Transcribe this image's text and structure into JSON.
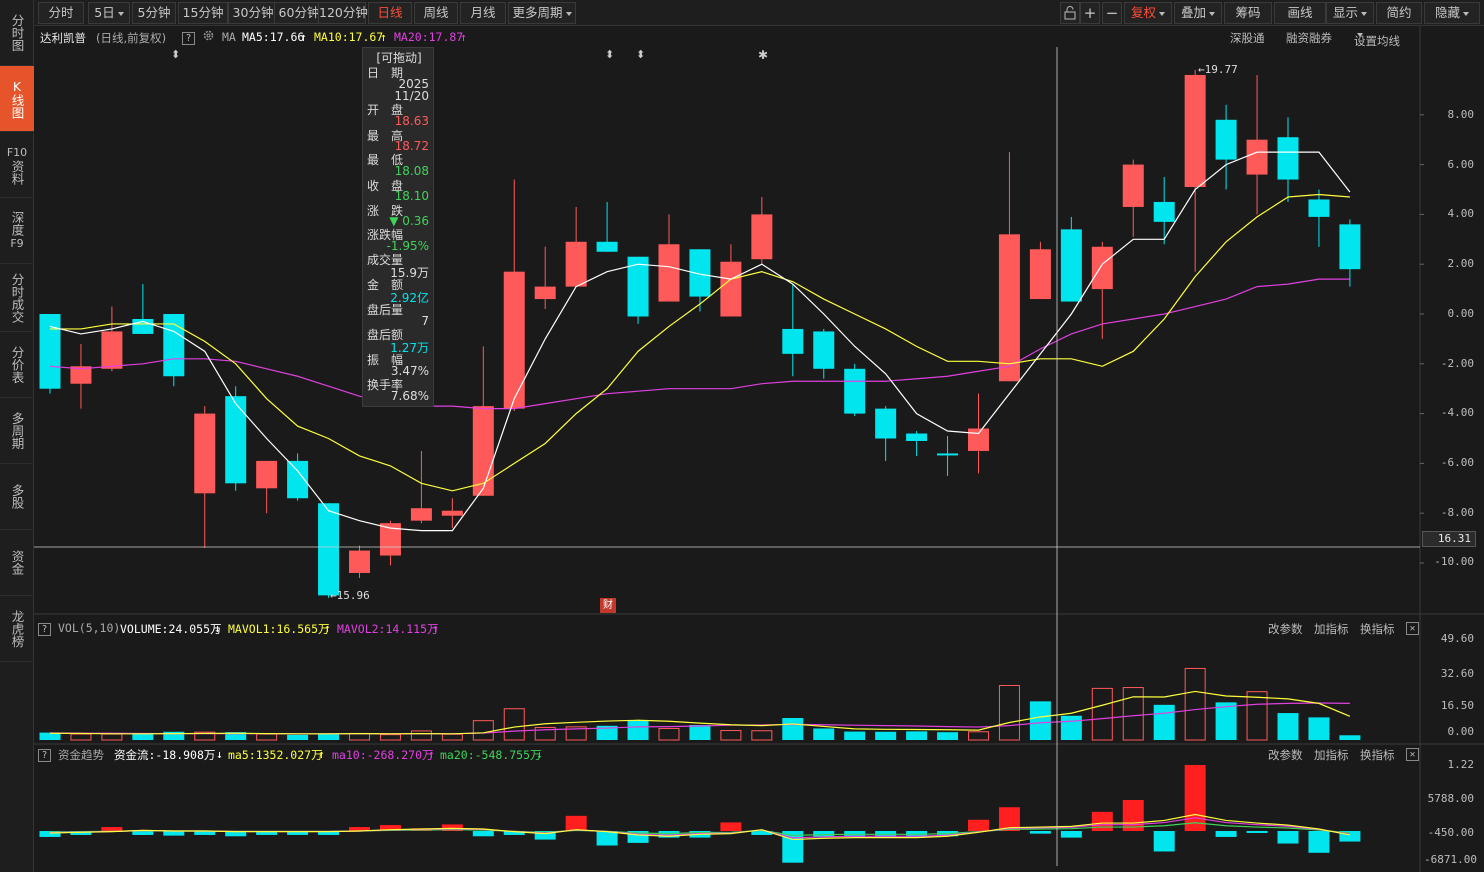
{
  "sidebar": {
    "items": [
      {
        "label": "分时图"
      },
      {
        "label": "K线图"
      },
      {
        "label_top": "F10",
        "label": "资料"
      },
      {
        "label": "深度",
        "label_bottom": "F9"
      },
      {
        "label": "分时成交"
      },
      {
        "label": "分价表"
      },
      {
        "label": "多周期"
      },
      {
        "label": "多股"
      },
      {
        "label": "资金"
      },
      {
        "label": "龙虎榜"
      }
    ]
  },
  "toolbar": {
    "periods": [
      "分时",
      "5日",
      "5分钟",
      "15分钟",
      "30分钟",
      "60分钟",
      "120分钟",
      "日线",
      "周线",
      "月线",
      "更多周期"
    ],
    "active_period": "日线",
    "right_buttons": [
      "复权",
      "叠加",
      "筹码",
      "画线",
      "显示",
      "简约",
      "隐藏"
    ]
  },
  "info": {
    "stock_name": "达利凯普",
    "mode": "(日线,前复权)",
    "ma_label": "MA",
    "ma5": "MA5:17.66",
    "ma10": "MA10:17.67",
    "ma20": "MA20:17.87",
    "links": [
      "深股通",
      "融资融券",
      "设置均线"
    ]
  },
  "tooltip": {
    "title": "[可拖动]",
    "date_label": "日　期",
    "date_year": "2025",
    "date_md": "11/20",
    "open_label": "开　盘",
    "open": "18.63",
    "high_label": "最　高",
    "high": "18.72",
    "low_label": "最　低",
    "low": "18.08",
    "close_label": "收　盘",
    "close": "18.10",
    "change_label": "涨　跌",
    "change": "▼ 0.36",
    "pct_label": "涨跌幅",
    "pct": "-1.95%",
    "vol_label": "成交量",
    "vol": "15.9万",
    "amt_label": "金　额",
    "amt": "2.92亿",
    "ah_vol_label": "盘后量",
    "ah_vol": "7",
    "ah_amt_label": "盘后额",
    "ah_amt": "1.27万",
    "amp_label": "振　幅",
    "amp": "3.47%",
    "turn_label": "换手率",
    "turn": "7.68%"
  },
  "price_axis": [
    "8.00",
    "6.00",
    "4.00",
    "2.00",
    "0.00",
    "-2.00",
    "-4.00",
    "-6.00",
    "-8.00",
    "-10.00"
  ],
  "crosshair_value": "16.31",
  "high_marker": "19.77",
  "low_marker": "15.96",
  "cai_badge": "财",
  "vol_panel": {
    "name": "VOL(5,10)",
    "volume": "VOLUME:24.055万",
    "mavol1": "MAVOL1:16.565万",
    "mavol2": "MAVOL2:14.115万",
    "axis": [
      "49.60",
      "32.60",
      "16.50",
      "0.00"
    ]
  },
  "fund_panel": {
    "name": "资金趋势",
    "flow": "资金流:-18.908万",
    "ma5": "ma5:1352.027万",
    "ma10": "ma10:-268.270万",
    "ma20": "ma20:-548.755万",
    "axis": [
      "1.22",
      "5788.00",
      "-450.00",
      "-6871.00"
    ]
  },
  "panel_links": [
    "改参数",
    "加指标",
    "换指标"
  ],
  "colors": {
    "up": "#ff5a5a",
    "down": "#00e5ee",
    "ma5": "#ffffff",
    "ma10": "#ffff3c",
    "ma20": "#e040e0",
    "accent": "#e5542a"
  },
  "chart_data": {
    "type": "candlestick",
    "price_axis_range": [
      -10.0,
      8.0
    ],
    "candles": [
      {
        "o": 0.0,
        "c": -3.0,
        "h": 0.0,
        "l": -3.2,
        "up": false
      },
      {
        "o": -2.8,
        "c": -2.1,
        "h": -1.2,
        "l": -3.8,
        "up": true
      },
      {
        "o": -2.2,
        "c": -0.7,
        "h": 0.3,
        "l": -2.3,
        "up": true
      },
      {
        "o": -0.2,
        "c": -0.8,
        "h": 1.2,
        "l": -0.8,
        "up": false
      },
      {
        "o": 0.0,
        "c": -2.5,
        "h": 0.0,
        "l": -2.9,
        "up": false
      },
      {
        "o": -7.2,
        "c": -4.0,
        "h": -3.7,
        "l": -9.4,
        "up": true
      },
      {
        "o": -3.3,
        "c": -6.8,
        "h": -2.9,
        "l": -7.1,
        "up": false
      },
      {
        "o": -7.0,
        "c": -5.9,
        "h": -5.9,
        "l": -8.0,
        "up": true
      },
      {
        "o": -5.9,
        "c": -7.4,
        "h": -5.6,
        "l": -7.5,
        "up": false
      },
      {
        "o": -7.6,
        "c": -11.3,
        "h": -7.6,
        "l": -11.4,
        "up": false
      },
      {
        "o": -10.4,
        "c": -9.5,
        "h": -9.3,
        "l": -10.6,
        "up": true
      },
      {
        "o": -9.7,
        "c": -8.4,
        "h": -8.3,
        "l": -10.1,
        "up": true
      },
      {
        "o": -8.3,
        "c": -7.8,
        "h": -5.5,
        "l": -8.4,
        "up": true
      },
      {
        "o": -8.1,
        "c": -7.9,
        "h": -7.4,
        "l": -8.6,
        "up": true
      },
      {
        "o": -7.3,
        "c": -3.7,
        "h": -1.3,
        "l": -7.3,
        "up": true
      },
      {
        "o": -3.8,
        "c": 1.7,
        "h": 5.4,
        "l": -3.9,
        "up": true
      },
      {
        "o": 0.6,
        "c": 1.1,
        "h": 2.7,
        "l": 0.2,
        "up": true
      },
      {
        "o": 1.1,
        "c": 2.9,
        "h": 4.3,
        "l": 1.1,
        "up": true
      },
      {
        "o": 2.9,
        "c": 2.5,
        "h": 4.5,
        "l": 2.5,
        "up": false
      },
      {
        "o": 2.3,
        "c": -0.1,
        "h": 2.3,
        "l": -0.4,
        "up": false
      },
      {
        "o": 0.5,
        "c": 2.8,
        "h": 4.0,
        "l": 0.5,
        "up": true
      },
      {
        "o": 2.6,
        "c": 0.7,
        "h": 2.6,
        "l": 0.1,
        "up": false
      },
      {
        "o": -0.1,
        "c": 2.1,
        "h": 2.8,
        "l": -0.1,
        "up": true
      },
      {
        "o": 2.2,
        "c": 4.0,
        "h": 4.7,
        "l": 2.0,
        "up": true
      },
      {
        "o": -0.6,
        "c": -1.6,
        "h": 1.2,
        "l": -2.5,
        "up": false
      },
      {
        "o": -0.7,
        "c": -2.2,
        "h": -0.6,
        "l": -2.6,
        "up": false
      },
      {
        "o": -2.2,
        "c": -4.0,
        "h": -2.0,
        "l": -4.1,
        "up": false
      },
      {
        "o": -3.8,
        "c": -5.0,
        "h": -3.7,
        "l": -5.9,
        "up": false
      },
      {
        "o": -4.8,
        "c": -5.1,
        "h": -4.7,
        "l": -5.7,
        "up": false
      },
      {
        "o": -5.6,
        "c": -5.6,
        "h": -4.9,
        "l": -6.5,
        "up": false
      },
      {
        "o": -5.5,
        "c": -4.6,
        "h": -3.2,
        "l": -6.4,
        "up": true
      },
      {
        "o": -2.7,
        "c": 3.2,
        "h": 6.5,
        "l": -2.7,
        "up": true
      },
      {
        "o": 0.6,
        "c": 2.6,
        "h": 2.9,
        "l": 0.6,
        "up": true
      },
      {
        "o": 3.4,
        "c": 0.5,
        "h": 3.9,
        "l": 0.5,
        "up": false
      },
      {
        "o": 1.0,
        "c": 2.7,
        "h": 2.9,
        "l": -1.0,
        "up": true
      },
      {
        "o": 4.3,
        "c": 6.0,
        "h": 6.2,
        "l": 3.1,
        "up": true
      },
      {
        "o": 4.5,
        "c": 3.7,
        "h": 5.5,
        "l": 2.8,
        "up": false
      },
      {
        "o": 5.1,
        "c": 9.6,
        "h": 9.8,
        "l": 1.7,
        "up": true
      },
      {
        "o": 7.8,
        "c": 6.2,
        "h": 8.4,
        "l": 5.0,
        "up": false
      },
      {
        "o": 5.6,
        "c": 7.0,
        "h": 9.6,
        "l": 4.0,
        "up": true
      },
      {
        "o": 7.1,
        "c": 5.4,
        "h": 7.9,
        "l": 4.5,
        "up": false
      },
      {
        "o": 4.6,
        "c": 3.9,
        "h": 5.0,
        "l": 2.7,
        "up": false
      },
      {
        "o": 3.6,
        "c": 1.8,
        "h": 3.8,
        "l": 1.1,
        "up": false
      }
    ],
    "ma5": [
      -0.5,
      -0.8,
      -0.6,
      -0.3,
      -0.7,
      -1.5,
      -3.6,
      -5.0,
      -6.3,
      -7.9,
      -8.3,
      -8.6,
      -8.7,
      -8.7,
      -7.0,
      -3.4,
      -1.0,
      1.1,
      1.7,
      2.0,
      1.9,
      1.6,
      1.4,
      2.0,
      1.2,
      0.0,
      -1.3,
      -2.4,
      -4.0,
      -4.7,
      -4.8,
      -3.2,
      -1.6,
      0.0,
      2.0,
      3.0,
      3.0,
      5.0,
      6.0,
      6.5,
      6.5,
      6.5,
      4.9
    ],
    "ma10": [
      -0.6,
      -0.6,
      -0.4,
      -0.4,
      -0.4,
      -1.1,
      -2.0,
      -3.4,
      -4.5,
      -5.0,
      -5.7,
      -6.1,
      -6.8,
      -7.1,
      -6.8,
      -6.0,
      -5.2,
      -4.0,
      -3.0,
      -1.5,
      -0.5,
      0.4,
      1.4,
      1.7,
      1.3,
      0.6,
      0.0,
      -0.6,
      -1.3,
      -1.9,
      -1.9,
      -2.0,
      -1.8,
      -1.8,
      -2.1,
      -1.5,
      -0.2,
      1.5,
      2.9,
      3.9,
      4.7,
      4.8,
      4.7
    ],
    "ma20": [
      -2.1,
      -2.2,
      -2.1,
      -2.0,
      -1.8,
      -1.8,
      -1.9,
      -2.2,
      -2.5,
      -2.9,
      -3.3,
      -3.6,
      -3.7,
      -3.7,
      -3.8,
      -3.8,
      -3.6,
      -3.4,
      -3.2,
      -3.1,
      -3.0,
      -3.0,
      -3.0,
      -2.8,
      -2.7,
      -2.7,
      -2.7,
      -2.7,
      -2.6,
      -2.5,
      -2.3,
      -2.1,
      -1.4,
      -0.8,
      -0.4,
      -0.2,
      0.0,
      0.3,
      0.6,
      1.1,
      1.2,
      1.4,
      1.4
    ],
    "volume": [
      3.6,
      2.9,
      2.9,
      3.1,
      4.0,
      3.8,
      3.8,
      2.9,
      2.5,
      3.2,
      3.2,
      2.6,
      4.4,
      2.8,
      9.4,
      15.2,
      6.1,
      6.4,
      6.9,
      9.6,
      5.6,
      7.3,
      4.6,
      4.5,
      10.7,
      5.6,
      4.1,
      4.0,
      4.2,
      3.8,
      4.0,
      26.5,
      18.8,
      11.8,
      25.1,
      25.5,
      17.1,
      34.8,
      18.3,
      23.5,
      13.1,
      11.0,
      2.3
    ],
    "vol_up": [
      false,
      true,
      true,
      false,
      false,
      true,
      false,
      true,
      false,
      false,
      true,
      true,
      true,
      true,
      true,
      true,
      true,
      true,
      false,
      false,
      true,
      false,
      true,
      true,
      false,
      false,
      false,
      false,
      false,
      false,
      true,
      true,
      false,
      false,
      true,
      true,
      false,
      true,
      false,
      true,
      false,
      false,
      false
    ],
    "mavol1": [
      3.3,
      3.2,
      3.0,
      3.0,
      3.1,
      3.2,
      3.3,
      3.1,
      3.0,
      3.0,
      3.1,
      3.0,
      3.1,
      3.0,
      3.5,
      6.3,
      7.9,
      8.6,
      9.2,
      9.6,
      9.1,
      8.2,
      7.4,
      7.0,
      7.8,
      6.6,
      5.4,
      5.2,
      5.1,
      5.0,
      4.8,
      8.5,
      11.2,
      13.0,
      16.9,
      21.0,
      20.9,
      23.6,
      21.4,
      20.8,
      20.0,
      17.8,
      11.5
    ],
    "mavol2": [
      3.4,
      3.3,
      3.3,
      3.2,
      3.1,
      3.1,
      3.1,
      3.1,
      3.0,
      3.0,
      3.0,
      3.0,
      3.0,
      3.0,
      3.4,
      4.3,
      5.0,
      5.4,
      5.8,
      6.4,
      6.5,
      6.8,
      7.2,
      7.3,
      7.6,
      7.4,
      7.2,
      7.0,
      6.8,
      6.5,
      6.3,
      7.0,
      8.4,
      9.1,
      10.4,
      11.8,
      13.0,
      14.8,
      16.2,
      17.4,
      17.8,
      18.0,
      17.8
    ],
    "fund_flow": [
      -0.9,
      -0.6,
      0.6,
      -0.6,
      -0.7,
      -0.6,
      -0.8,
      -0.6,
      -0.6,
      -0.6,
      0.6,
      0.9,
      0.4,
      1.0,
      -0.8,
      -0.6,
      -1.3,
      2.3,
      -2.2,
      -1.8,
      -1.0,
      -1.0,
      1.3,
      -0.6,
      -4.8,
      -0.9,
      -0.9,
      -1.0,
      -0.9,
      -0.8,
      1.7,
      3.6,
      -0.4,
      -1.0,
      2.9,
      4.7,
      -3.1,
      10.0,
      -0.9,
      -0.3,
      -1.9,
      -3.3,
      -1.6
    ],
    "fund_ma": [
      -0.3,
      -0.2,
      -0.1,
      0.1,
      0.0,
      0.0,
      -0.1,
      -0.1,
      -0.1,
      -0.1,
      0.0,
      0.2,
      0.3,
      0.4,
      0.3,
      -0.1,
      -0.4,
      0.2,
      -0.1,
      -0.6,
      -0.8,
      -0.5,
      -0.4,
      0.2,
      -1.3,
      -1.1,
      -1.0,
      -1.0,
      -1.0,
      -0.8,
      -0.2,
      0.5,
      0.6,
      0.7,
      1.2,
      1.2,
      1.6,
      2.5,
      1.6,
      1.2,
      0.9,
      0.3,
      -0.6
    ]
  }
}
